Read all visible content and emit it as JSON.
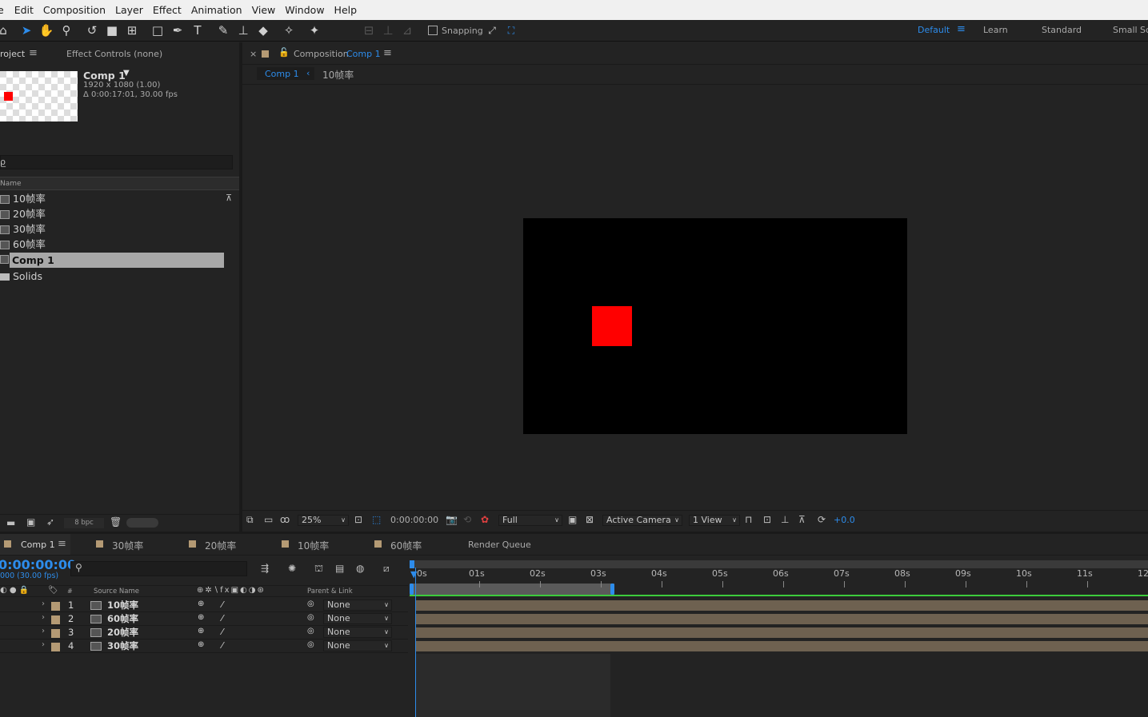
{
  "menu": [
    "e",
    "Edit",
    "Composition",
    "Layer",
    "Effect",
    "Animation",
    "View",
    "Window",
    "Help"
  ],
  "toolbar": {
    "snapping_label": "Snapping",
    "workspaces": [
      "Default",
      "Learn",
      "Standard",
      "Small Sc"
    ]
  },
  "project": {
    "tab_label": "roject",
    "effect_controls_label": "Effect Controls (none)",
    "comp_name": "Comp 1",
    "comp_size": "1920 x 1080 (1.00)",
    "comp_duration": "Δ 0:00:17:01, 30.00 fps",
    "search_glyph": "ρ̲",
    "name_header": "Name",
    "items": [
      "10帧率",
      "20帧率",
      "30帧率",
      "60帧率",
      "Comp 1",
      "Solids"
    ],
    "bpc_label": "8 bpc"
  },
  "viewer": {
    "close": "×",
    "tab_prefix": "Composition",
    "tab_comp": "Comp 1",
    "breadcrumb_comp": "Comp 1",
    "breadcrumb_sep": "‹",
    "breadcrumb_next": "10帧率",
    "zoom": "25%",
    "timecode": "0:00:00:00",
    "resolution": "Full",
    "camera": "Active Camera",
    "views": "1 View",
    "exposure": "+0.0",
    "colors": {
      "comp_bg": "#000000",
      "solid": "#ff0000"
    }
  },
  "timeline": {
    "tabs": [
      "Comp 1",
      "30帧率",
      "20帧率",
      "10帧率",
      "60帧率"
    ],
    "render_queue_label": "Render Queue",
    "timecode": "0:00:00:00",
    "fps_sub": "000 (30.00 fps)",
    "col_num": "#",
    "col_source": "Source Name",
    "col_parent": "Parent & Link",
    "ruler_labels": [
      "0s",
      "01s",
      "02s",
      "03s",
      "04s",
      "05s",
      "06s",
      "07s",
      "08s",
      "09s",
      "10s",
      "11s",
      "12"
    ],
    "layers": [
      {
        "num": "1",
        "name": "10帧率",
        "parent": "None"
      },
      {
        "num": "2",
        "name": "60帧率",
        "parent": "None"
      },
      {
        "num": "3",
        "name": "20帧率",
        "parent": "None"
      },
      {
        "num": "4",
        "name": "30帧率",
        "parent": "None"
      }
    ]
  }
}
